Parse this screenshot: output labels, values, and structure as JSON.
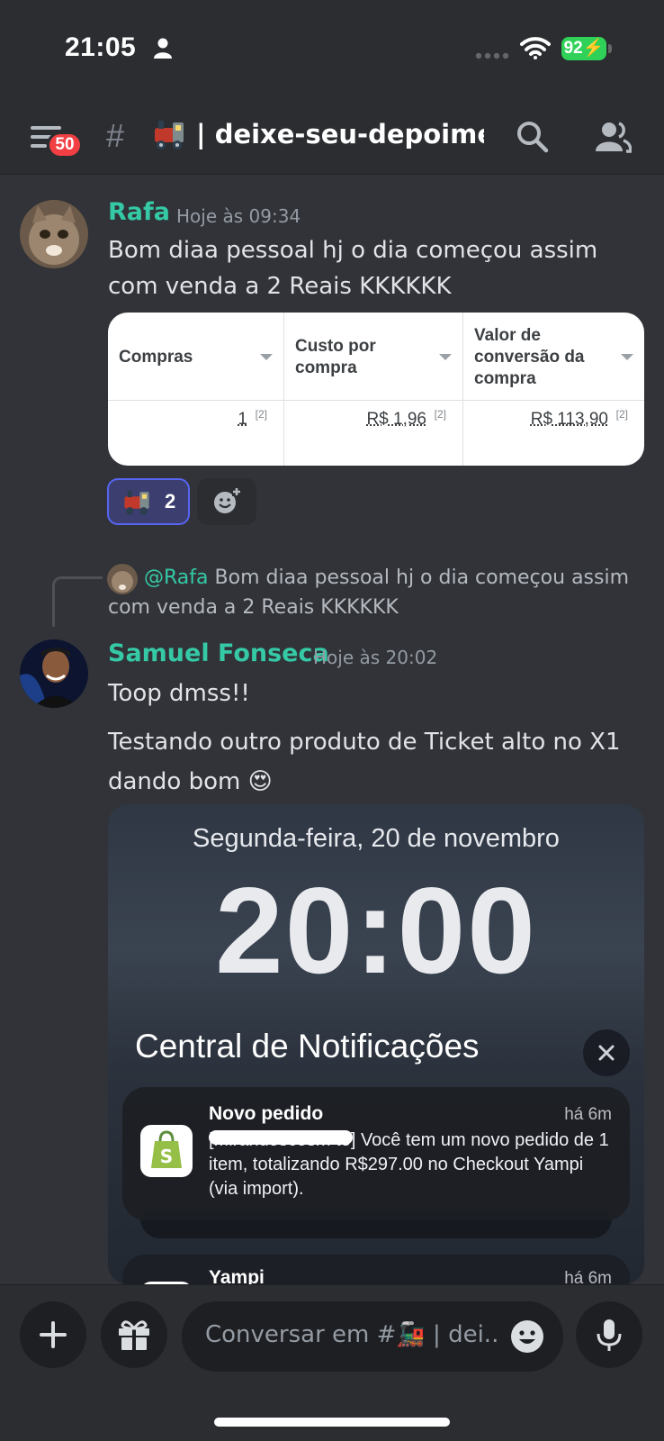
{
  "status_bar": {
    "time": "21:05",
    "battery": "92"
  },
  "header": {
    "badge_count": "50",
    "hash": "#",
    "channel_name": "| deixe-seu-depoimen..."
  },
  "messages": [
    {
      "author": "Rafa",
      "timestamp": "Hoje às 09:34",
      "text": "Bom diaa pessoal hj o dia começou assim com venda a 2 Reais KKKKKK",
      "embed_table": {
        "columns": [
          {
            "header": "Compras",
            "value": "1",
            "note": "[2]"
          },
          {
            "header": "Custo por compra",
            "value": "R$ 1,96",
            "note": "[2]"
          },
          {
            "header": "Valor de conversão da compra",
            "value": "R$ 113,90",
            "note": "[2]"
          }
        ]
      },
      "reactions": [
        {
          "emoji": "train-emoji",
          "count": "2"
        }
      ]
    },
    {
      "reply_to": {
        "mention": "@Rafa",
        "text": "Bom diaa pessoal hj o dia começou assim com venda a 2 Reais KKKKKK"
      },
      "author": "Samuel Fonseca",
      "timestamp": "Hoje às 20:02",
      "lines": [
        "Toop dmss!!",
        "Testando outro produto de Ticket alto no X1 dando bom 😍"
      ],
      "attachment": {
        "date": "Segunda-feira, 20 de novembro",
        "clock": "20:00",
        "notification_center": "Central de Notificações",
        "notifications": [
          {
            "title": "Novo pedido",
            "time": "há 6m",
            "body": "[Mirandoscosm to] Você tem um novo pedido de 1 item, totalizando R$297.00 no Checkout Yampi (via import)."
          },
          {
            "title": "Yampi",
            "time": "há 6m"
          }
        ]
      }
    }
  ],
  "composer": {
    "placeholder": "Conversar em #🚂 | dei.."
  },
  "colors": {
    "background": "#313338",
    "accent_green": "#35c9a6",
    "reaction_blue": "#5865f2",
    "badge_red": "#f23f43"
  }
}
